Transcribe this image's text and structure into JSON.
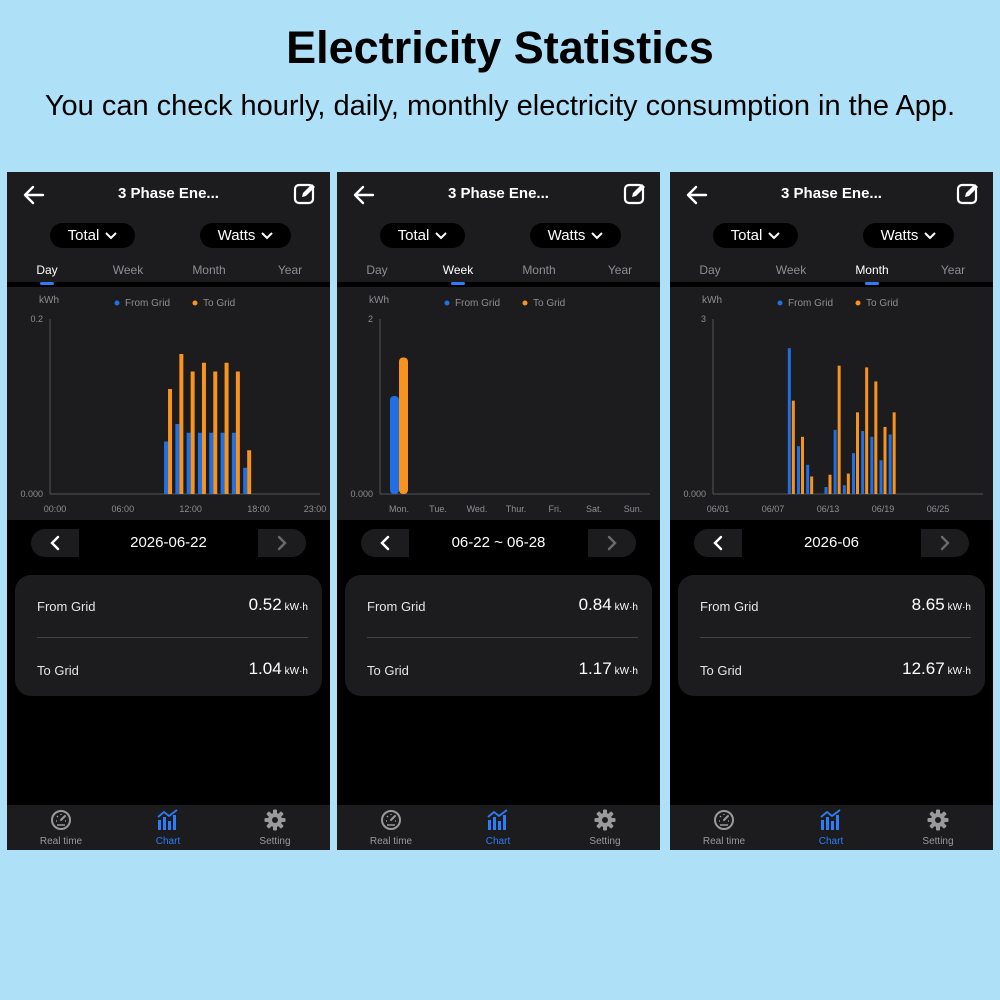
{
  "headline": "Electricity Statistics",
  "subline": "You can check hourly, daily, monthly electricity consumption in the App.",
  "colors": {
    "from_grid": "#1f6fe5",
    "to_grid": "#f7931e",
    "accent": "#2f7cf6"
  },
  "icons": {
    "back": "arrow-left-icon",
    "edit": "edit-icon",
    "realtime": "gauge-icon",
    "chart": "bar-chart-icon",
    "setting": "gear-icon"
  },
  "screens": [
    {
      "title": "3 Phase Ene...",
      "dropdown_total": "Total",
      "dropdown_watts": "Watts",
      "tabs": [
        "Day",
        "Week",
        "Month",
        "Year"
      ],
      "active_tab": 0,
      "date_label": "2026-06-22",
      "summary": {
        "from_label": "From Grid",
        "from_value": "0.52",
        "from_unit": "kW·h",
        "to_label": "To Grid",
        "to_value": "1.04",
        "to_unit": "kW·h"
      },
      "nav": [
        "Real time",
        "Chart",
        "Setting"
      ]
    },
    {
      "title": "3 Phase Ene...",
      "dropdown_total": "Total",
      "dropdown_watts": "Watts",
      "tabs": [
        "Day",
        "Week",
        "Month",
        "Year"
      ],
      "active_tab": 1,
      "date_label": "06-22 ~ 06-28",
      "summary": {
        "from_label": "From Grid",
        "from_value": "0.84",
        "from_unit": "kW·h",
        "to_label": "To Grid",
        "to_value": "1.17",
        "to_unit": "kW·h"
      },
      "nav": [
        "Real time",
        "Chart",
        "Setting"
      ]
    },
    {
      "title": "3 Phase Ene...",
      "dropdown_total": "Total",
      "dropdown_watts": "Watts",
      "tabs": [
        "Day",
        "Week",
        "Month",
        "Year"
      ],
      "active_tab": 2,
      "date_label": "2026-06",
      "summary": {
        "from_label": "From Grid",
        "from_value": "8.65",
        "from_unit": "kW·h",
        "to_label": "To Grid",
        "to_value": "12.67",
        "to_unit": "kW·h"
      },
      "nav": [
        "Real time",
        "Chart",
        "Setting"
      ]
    }
  ],
  "chart_data": [
    {
      "type": "bar",
      "ylabel": "kWh",
      "ylim": [
        0,
        0.2
      ],
      "ytick_labels": [
        "0.000",
        "0.2"
      ],
      "xtick_labels": [
        "00:00",
        "06:00",
        "12:00",
        "18:00",
        "23:00"
      ],
      "legend_position": "top",
      "x": [
        10,
        11,
        12,
        13,
        14,
        15,
        16,
        17
      ],
      "series": [
        {
          "name": "From Grid",
          "values": [
            0.06,
            0.08,
            0.07,
            0.07,
            0.07,
            0.07,
            0.07,
            0.03
          ]
        },
        {
          "name": "To Grid",
          "values": [
            0.12,
            0.16,
            0.14,
            0.15,
            0.14,
            0.15,
            0.14,
            0.05
          ]
        }
      ]
    },
    {
      "type": "bar",
      "ylabel": "kWh",
      "ylim": [
        0,
        2
      ],
      "ytick_labels": [
        "0.000",
        "2"
      ],
      "categories": [
        "Mon.",
        "Tue.",
        "Wed.",
        "Thur.",
        "Fri.",
        "Sat.",
        "Sun."
      ],
      "legend_position": "top",
      "series": [
        {
          "name": "From Grid",
          "values": [
            1.12,
            0,
            0,
            0,
            0,
            0,
            0
          ]
        },
        {
          "name": "To Grid",
          "values": [
            1.56,
            0,
            0,
            0,
            0,
            0,
            0
          ]
        }
      ]
    },
    {
      "type": "bar",
      "ylabel": "kWh",
      "ylim": [
        0,
        3
      ],
      "ytick_labels": [
        "0.000",
        "3"
      ],
      "xtick_labels": [
        "06/01",
        "06/07",
        "06/13",
        "06/19",
        "06/25"
      ],
      "legend_position": "top",
      "x": [
        9,
        10,
        11,
        13,
        14,
        15,
        16,
        17,
        18,
        19,
        20
      ],
      "series": [
        {
          "name": "From Grid",
          "values": [
            2.5,
            0.82,
            0.5,
            0.12,
            1.1,
            0.15,
            0.7,
            1.08,
            0.98,
            0.58,
            1.02
          ]
        },
        {
          "name": "To Grid",
          "values": [
            1.6,
            0.98,
            0.3,
            0.33,
            2.2,
            0.35,
            1.4,
            2.17,
            1.93,
            1.15,
            1.4
          ]
        }
      ]
    }
  ]
}
